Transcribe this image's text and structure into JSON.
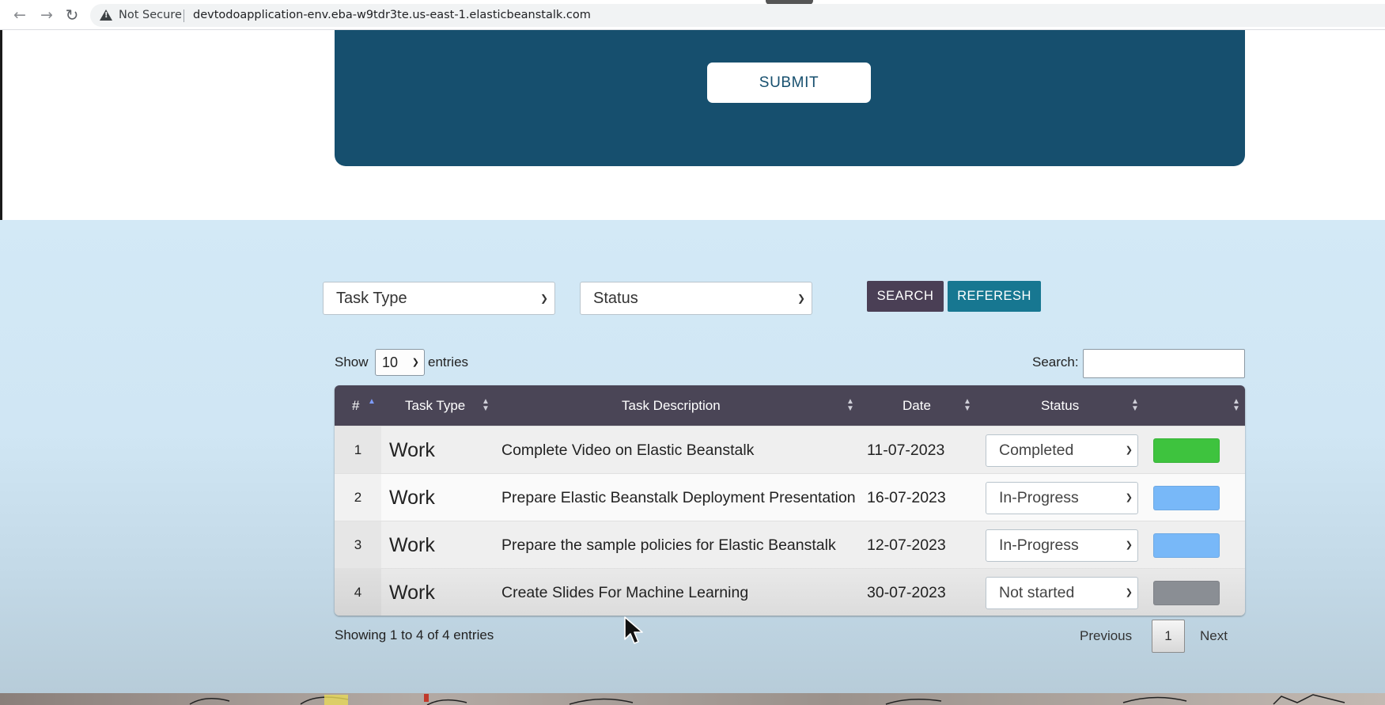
{
  "browser": {
    "security_label": "Not Secure",
    "url": "devtodoapplication-env.eba-w9tdr3te.us-east-1.elasticbeanstalk.com"
  },
  "form": {
    "submit_label": "SUBMIT"
  },
  "filters": {
    "task_type_value": "Task Type",
    "status_value": "Status",
    "search_label": "SEARCH",
    "refresh_label": "REFERESH"
  },
  "table_controls": {
    "show_label": "Show",
    "entries_value": "10",
    "entries_label": "entries",
    "search_label": "Search:"
  },
  "table": {
    "columns": [
      "#",
      "Task Type",
      "Task Description",
      "Date",
      "Status",
      ""
    ],
    "rows": [
      {
        "num": "1",
        "type": "Work",
        "description": "Complete Video on Elastic Beanstalk",
        "date": "11-07-2023",
        "status": "Completed",
        "color": "#3ec33e"
      },
      {
        "num": "2",
        "type": "Work",
        "description": "Prepare Elastic Beanstalk Deployment Presentation",
        "date": "16-07-2023",
        "status": "In-Progress",
        "color": "#78b8f8"
      },
      {
        "num": "3",
        "type": "Work",
        "description": "Prepare the sample policies for Elastic Beanstalk",
        "date": "12-07-2023",
        "status": "In-Progress",
        "color": "#78b8f8"
      },
      {
        "num": "4",
        "type": "Work",
        "description": "Create Slides For Machine Learning",
        "date": "30-07-2023",
        "status": "Not started",
        "color": "#8a8e94"
      }
    ]
  },
  "pagination": {
    "info": "Showing 1 to 4 of 4 entries",
    "previous_label": "Previous",
    "current_page": "1",
    "next_label": "Next"
  },
  "colors": {
    "form_panel": "#164f6e",
    "search_button": "#4a3f55",
    "refresh_button": "#177791",
    "table_header": "#4a4556"
  }
}
